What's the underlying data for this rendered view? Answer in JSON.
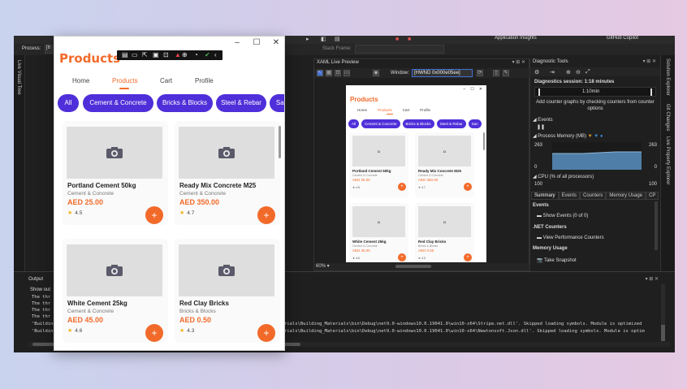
{
  "ide": {
    "process_label": "Process:",
    "process_value": "[6",
    "application_insights": "Application Insights",
    "github_copilot": "GitHub Copilot",
    "stack_frame_label": "Stack Frame:",
    "left_strip_label": "Live Visual Tree",
    "right_strip_labels": [
      "Solution Explorer",
      "Git Changes",
      "Live Property Explorer"
    ]
  },
  "xaml_preview": {
    "title": "XAML Live Preview",
    "window_label": "Window:",
    "window_value": "[HWND 0x000e05ee]",
    "zoom": "60%"
  },
  "diagnostics": {
    "title": "Diagnostic Tools",
    "session": "Diagnostics session: 1:18 minutes",
    "timeline_label": "1:10min",
    "add_counter_text": "Add counter graphs by checking counters from counter options",
    "events_header": "Events",
    "process_memory_header": "Process Memory (MB)",
    "pm_top_left": "263",
    "pm_top_right": "263",
    "pm_bottom_left": "0",
    "pm_bottom_right": "0",
    "cpu_header": "CPU (% of all processors)",
    "cpu_left": "100",
    "cpu_right": "100",
    "tabs": [
      "Summary",
      "Events",
      "Counters",
      "Memory Usage",
      "CP"
    ],
    "section_events": "Events",
    "show_events": "Show Events (0 of 0)",
    "section_net": ".NET Counters",
    "view_perf": "View Performance Counters",
    "section_memory": "Memory Usage",
    "take_snapshot": "Take Snapshot"
  },
  "output": {
    "title": "Output",
    "show_output": "Show out",
    "lines": [
      "The thr",
      "The thr",
      "The thr",
      "The thr",
      "'Buildin",
      "'Buildin"
    ],
    "line_tails": [
      "rials\\Building_Materials\\bin\\Debug\\net9.0-windows10.0.19041.0\\win10-x64\\Stripe.net.dll'. Skipped loading symbols. Module is optimized",
      "rials\\Building_Materials\\bin\\Debug\\net9.0-windows10.0.19041.0\\win10-x64\\Newtonsoft.Json.dll'. Skipped loading symbols. Module is optim"
    ]
  },
  "app": {
    "title": "Products",
    "window_controls": {
      "minimize": "–",
      "maximize": "☐",
      "close": "✕"
    },
    "nav": [
      "Home",
      "Products",
      "Cart",
      "Profile"
    ],
    "active_nav": "Products",
    "chips": [
      "All",
      "Cement & Concrete",
      "Bricks & Blocks",
      "Steel & Rebar",
      "San"
    ],
    "add_label": "+",
    "products": [
      {
        "name": "Portland Cement 50kg",
        "category": "Cement & Concrete",
        "price": "AED 25.00",
        "rating": "4.5"
      },
      {
        "name": "Ready Mix Concrete M25",
        "category": "Cement & Concrete",
        "price": "AED 350.00",
        "rating": "4.7"
      },
      {
        "name": "White Cement 25kg",
        "category": "Cement & Concrete",
        "price": "AED 45.00",
        "rating": "4.6"
      },
      {
        "name": "Red Clay Bricks",
        "category": "Bricks & Blocks",
        "price": "AED 0.50",
        "rating": "4.3"
      }
    ]
  },
  "colors": {
    "accent_orange": "#f26a2a",
    "chip_purple": "#4f2fd9",
    "ide_bg": "#1f1f1f",
    "memory_fill": "#4f7fa8"
  }
}
